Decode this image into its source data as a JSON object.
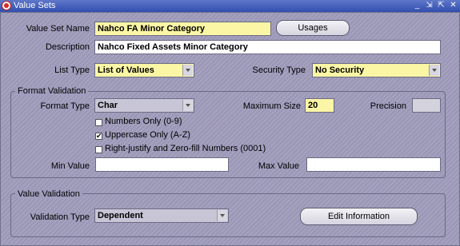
{
  "window": {
    "title": "Value Sets",
    "controls": {
      "minimize": "_",
      "restore": "⇲",
      "maximize": "⇱",
      "close": "✕"
    }
  },
  "header": {
    "value_set_name_label": "Value Set Name",
    "value_set_name": "Nahco FA Minor Category",
    "usages_button": "Usages",
    "description_label": "Description",
    "description": "Nahco Fixed Assets Minor Category",
    "list_type_label": "List Type",
    "list_type": "List of Values",
    "security_type_label": "Security Type",
    "security_type": "No Security"
  },
  "format_validation": {
    "group_title": "Format Validation",
    "format_type_label": "Format Type",
    "format_type": "Char",
    "maximum_size_label": "Maximum Size",
    "maximum_size": "20",
    "precision_label": "Precision",
    "precision": "",
    "checkboxes": [
      {
        "label": "Numbers Only (0-9)",
        "checked": false
      },
      {
        "label": "Uppercase Only (A-Z)",
        "checked": true
      },
      {
        "label": "Right-justify and Zero-fill Numbers (0001)",
        "checked": false
      }
    ],
    "min_value_label": "Min Value",
    "min_value": "",
    "max_value_label": "Max Value",
    "max_value": ""
  },
  "value_validation": {
    "group_title": "Value Validation",
    "validation_type_label": "Validation Type",
    "validation_type": "Dependent",
    "edit_information_button": "Edit Information"
  },
  "colors": {
    "background": "#a09cbc",
    "titlebar": "#314fae",
    "required_field": "#fbf6a5"
  }
}
